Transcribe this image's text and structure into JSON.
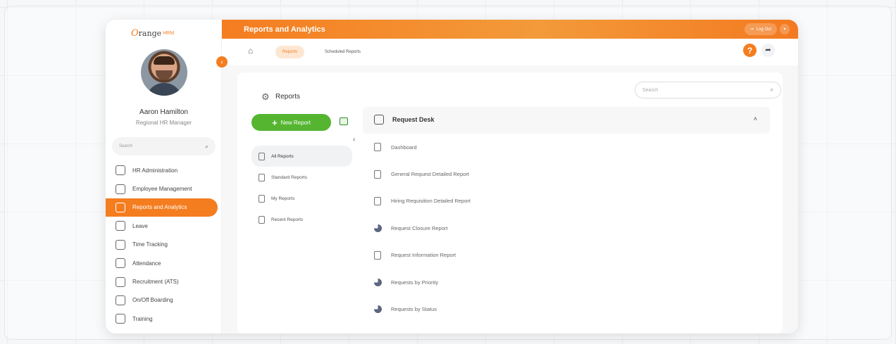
{
  "brand": {
    "logo_o": "O",
    "logo_word": "range",
    "logo_hrm": "HRM",
    "logo_sub": ""
  },
  "user": {
    "name": "Aaron Hamilton",
    "role": "Regional HR Manager"
  },
  "sidebar": {
    "search_placeholder": "Search",
    "items": [
      {
        "label": "HR Administration",
        "icon": "hr-admin-icon",
        "active": false
      },
      {
        "label": "Employee Management",
        "icon": "employees-icon",
        "active": false
      },
      {
        "label": "Reports and Analytics",
        "icon": "reports-icon",
        "active": true
      },
      {
        "label": "Leave",
        "icon": "leave-icon",
        "active": false
      },
      {
        "label": "Time Tracking",
        "icon": "time-tracking-icon",
        "active": false
      },
      {
        "label": "Attendance",
        "icon": "attendance-icon",
        "active": false
      },
      {
        "label": "Recruitment (ATS)",
        "icon": "recruitment-icon",
        "active": false
      },
      {
        "label": "On/Off Boarding",
        "icon": "onboarding-icon",
        "active": false
      },
      {
        "label": "Training",
        "icon": "training-icon",
        "active": false
      }
    ]
  },
  "header": {
    "title": "Reports and Analytics",
    "logout_label": "Log Out",
    "color": "#f47d20"
  },
  "subnav": {
    "tabs": [
      {
        "label": "Reports",
        "active": true
      },
      {
        "label": "Scheduled Reports",
        "active": false
      }
    ]
  },
  "reports_panel": {
    "title": "Reports",
    "search_placeholder": "Search",
    "new_report_label": "New Report",
    "nav": [
      {
        "label": "All Reports",
        "active": true
      },
      {
        "label": "Standard Reports",
        "active": false
      },
      {
        "label": "My Reports",
        "active": false
      },
      {
        "label": "Recent Reports",
        "active": false
      }
    ]
  },
  "request_desk": {
    "title": "Request Desk",
    "items": [
      {
        "label": "Dashboard",
        "icon": "document-icon"
      },
      {
        "label": "General Request Detailed Report",
        "icon": "document-icon"
      },
      {
        "label": "Hiring Requisition Detailed Report",
        "icon": "document-icon"
      },
      {
        "label": "Request Closure Report",
        "icon": "pie-chart-icon"
      },
      {
        "label": "Request Information Report",
        "icon": "document-icon"
      },
      {
        "label": "Requests by Priority",
        "icon": "pie-chart-icon"
      },
      {
        "label": "Requests by Status",
        "icon": "pie-chart-icon"
      }
    ]
  },
  "colors": {
    "accent": "#f47d20",
    "green": "#55b531"
  }
}
